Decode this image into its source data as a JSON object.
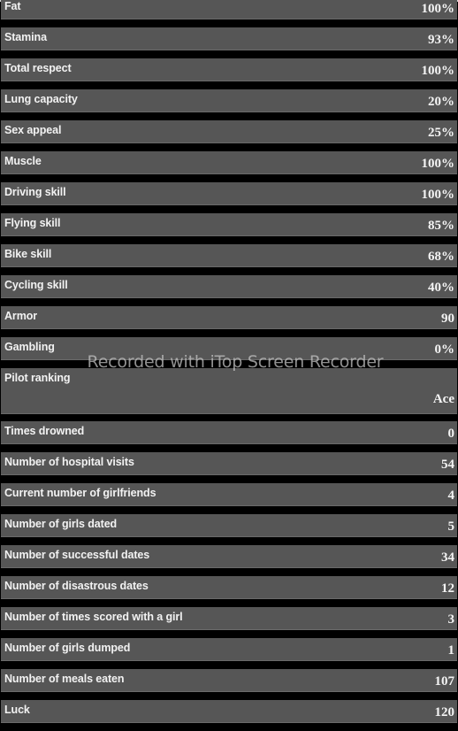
{
  "stats": [
    {
      "label": "Fat",
      "value": "100%"
    },
    {
      "label": "Stamina",
      "value": "93%"
    },
    {
      "label": "Total respect",
      "value": "100%"
    },
    {
      "label": "Lung capacity",
      "value": "20%"
    },
    {
      "label": "Sex appeal",
      "value": "25%"
    },
    {
      "label": "Muscle",
      "value": "100%"
    },
    {
      "label": "Driving skill",
      "value": "100%"
    },
    {
      "label": "Flying skill",
      "value": "85%"
    },
    {
      "label": "Bike skill",
      "value": "68%"
    },
    {
      "label": "Cycling skill",
      "value": "40%"
    },
    {
      "label": "Armor",
      "value": "90"
    },
    {
      "label": "Gambling",
      "value": "0%"
    },
    {
      "label": "Pilot ranking",
      "value": "Ace"
    },
    {
      "label": "Times drowned",
      "value": "0"
    },
    {
      "label": "Number of hospital visits",
      "value": "54"
    },
    {
      "label": "Current number of girlfriends",
      "value": "4"
    },
    {
      "label": "Number of girls dated",
      "value": "5"
    },
    {
      "label": "Number of successful dates",
      "value": "34"
    },
    {
      "label": "Number of disastrous dates",
      "value": "12"
    },
    {
      "label": "Number of times scored with a girl",
      "value": "3"
    },
    {
      "label": "Number of girls dumped",
      "value": "1"
    },
    {
      "label": "Number of meals eaten",
      "value": "107"
    },
    {
      "label": "Luck",
      "value": "120"
    }
  ],
  "watermark": "Recorded with iTop Screen Recorder",
  "colors": {
    "background": "#000000",
    "row": "#565656",
    "text": "#f2f2f2"
  }
}
